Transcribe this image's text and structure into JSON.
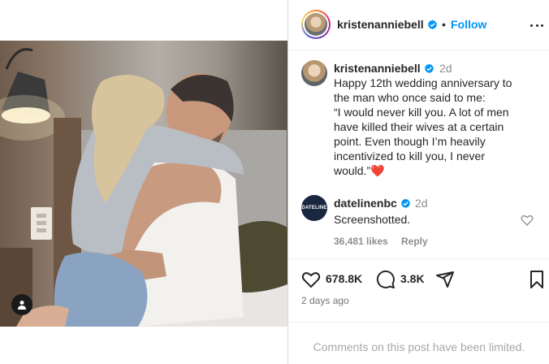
{
  "header": {
    "username": "kristenanniebell",
    "separator": "•",
    "follow_label": "Follow"
  },
  "comments": [
    {
      "username": "kristenanniebell",
      "time": "2d",
      "text": "Happy 12th wedding anniversary to\nthe man who once said to me:\n“I would never kill you. A lot of men\nhave killed their wives at a certain\npoint. Even though I’m heavily\nincentivized to kill you, I never\nwould.”❤️"
    },
    {
      "username": "datelinenbc",
      "avatar_text": "DATELINE",
      "time": "2d",
      "text": "Screenshotted.",
      "likes": "36,481 likes",
      "reply_label": "Reply"
    }
  ],
  "actions": {
    "likes_count": "678.8K",
    "comments_count": "3.8K",
    "date": "2 days ago"
  },
  "footer": {
    "limited_text": "Comments on this post have been limited."
  },
  "colors": {
    "link_blue": "#0095f6",
    "verified_blue": "#0095f6",
    "muted": "#8e8e8e"
  },
  "icons": [
    "verified-badge-icon",
    "more-options-icon",
    "heart-icon",
    "comment-icon",
    "share-icon",
    "bookmark-icon",
    "tagged-user-icon"
  ]
}
